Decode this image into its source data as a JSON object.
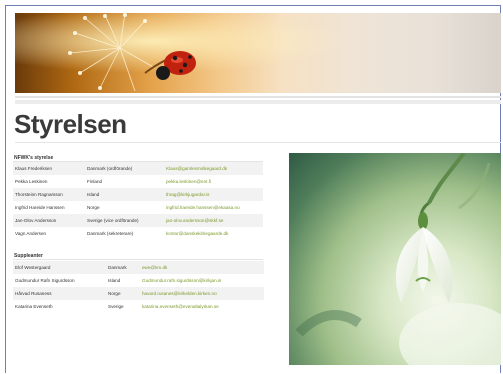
{
  "page": {
    "title": "Styrelsen"
  },
  "board": {
    "heading": "NFWK's styrelse",
    "members": [
      {
        "name": "Klaus Frederiksen",
        "country": "Danmark (ordförande)",
        "email": "Klaus@gamlesmolkegaard.dk"
      },
      {
        "name": "Pekka Leskinen",
        "country": "Finland",
        "email": "pekka.leskinen@ent.fi"
      },
      {
        "name": "Thorsteinn Ragnarsson",
        "country": "Island",
        "email": "thrag@kirkjugardar.is"
      },
      {
        "name": "Ingfrid Hareide Hanssen",
        "country": "Norge",
        "email": "ingfrid.hareide.hanssen@ekaasa.no"
      },
      {
        "name": "Jan-Olov Andersson",
        "country": "Sverige (vice ordförande)",
        "email": "jan-olov.andersson@skkf.se"
      },
      {
        "name": "Vagn Andersen",
        "country": "Danmark (sekreterare)",
        "email": "kontor@danskekirkegaarde.dk"
      }
    ]
  },
  "substitutes": {
    "heading": "Suppleanter",
    "members": [
      {
        "name": "Elof Westergaard",
        "country": "Danmark",
        "email": "ewe@km.dk"
      },
      {
        "name": "Gudmundur Rafn Sigurdsson",
        "country": "Island",
        "email": "Gudmundur.rafn.sigurdsson@kirkjan.is"
      },
      {
        "name": "Hårvad Rusaness",
        "country": "Norge",
        "email": "havard.rusanes@kirkelden.kirken.no"
      },
      {
        "name": "Katarina Evenseth",
        "country": "Sverige",
        "email": "katarina.evenseth@evenaltalyrkan.se"
      }
    ]
  },
  "colors": {
    "link": "#7a9a2a",
    "frame": "#6f7fb8",
    "row_alt": "#f2f2f2"
  },
  "images": {
    "banner": "ladybug-on-dandelion-banner",
    "side_photo": "snowdrop-flower-photo"
  }
}
